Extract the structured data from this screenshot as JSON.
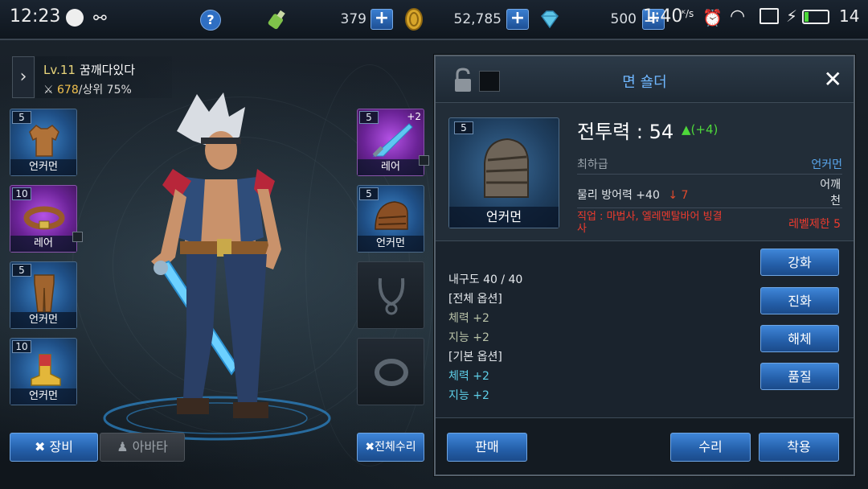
{
  "status_bar": {
    "time": "12:23",
    "clock": "1:40",
    "battery": "14"
  },
  "top_bar": {
    "stamina": "379",
    "gold": "52,785",
    "gems": "500"
  },
  "player": {
    "level": "Lv.11",
    "name": "꿈깨다있다",
    "power": "678",
    "rank": "/상위 75%"
  },
  "left_slots": [
    {
      "level": "5",
      "label": "언커먼"
    },
    {
      "level": "10",
      "label": "레어"
    },
    {
      "level": "5",
      "label": "언커먼"
    },
    {
      "level": "10",
      "label": "언커먼"
    }
  ],
  "right_slots": [
    {
      "level": "5",
      "plus": "+2",
      "label": "레어"
    },
    {
      "level": "5",
      "label": "언커먼"
    }
  ],
  "buttons": {
    "equip": "장비",
    "avatar": "아바타",
    "repair_all": "전체수리"
  },
  "item": {
    "title": "면 숄더",
    "level": "5",
    "grade_label": "언커먼",
    "power_label": "전투력 : 54",
    "power_delta": "(+4)",
    "tier": "최하급",
    "rarity": "언커먼",
    "stat_main": "물리 방어력 +40",
    "stat_down": "7",
    "slot_type": "어깨",
    "material": "천",
    "job_req": "직업 : 마법사, 엘레멘탈바어 빙결사",
    "level_req": "레벨제한 5",
    "durability": "내구도 40 / 40",
    "opt_all_header": "[전체 옵션]",
    "opt_all": [
      "체력 +2",
      "지능 +2"
    ],
    "opt_base_header": "[기본 옵션]",
    "opt_base": [
      "체력 +2",
      "지능 +2"
    ]
  },
  "item_actions": {
    "enhance": "강화",
    "evolve": "진화",
    "disassemble": "해체",
    "quality": "품질",
    "sell": "판매",
    "repair": "수리",
    "equip": "착용"
  }
}
